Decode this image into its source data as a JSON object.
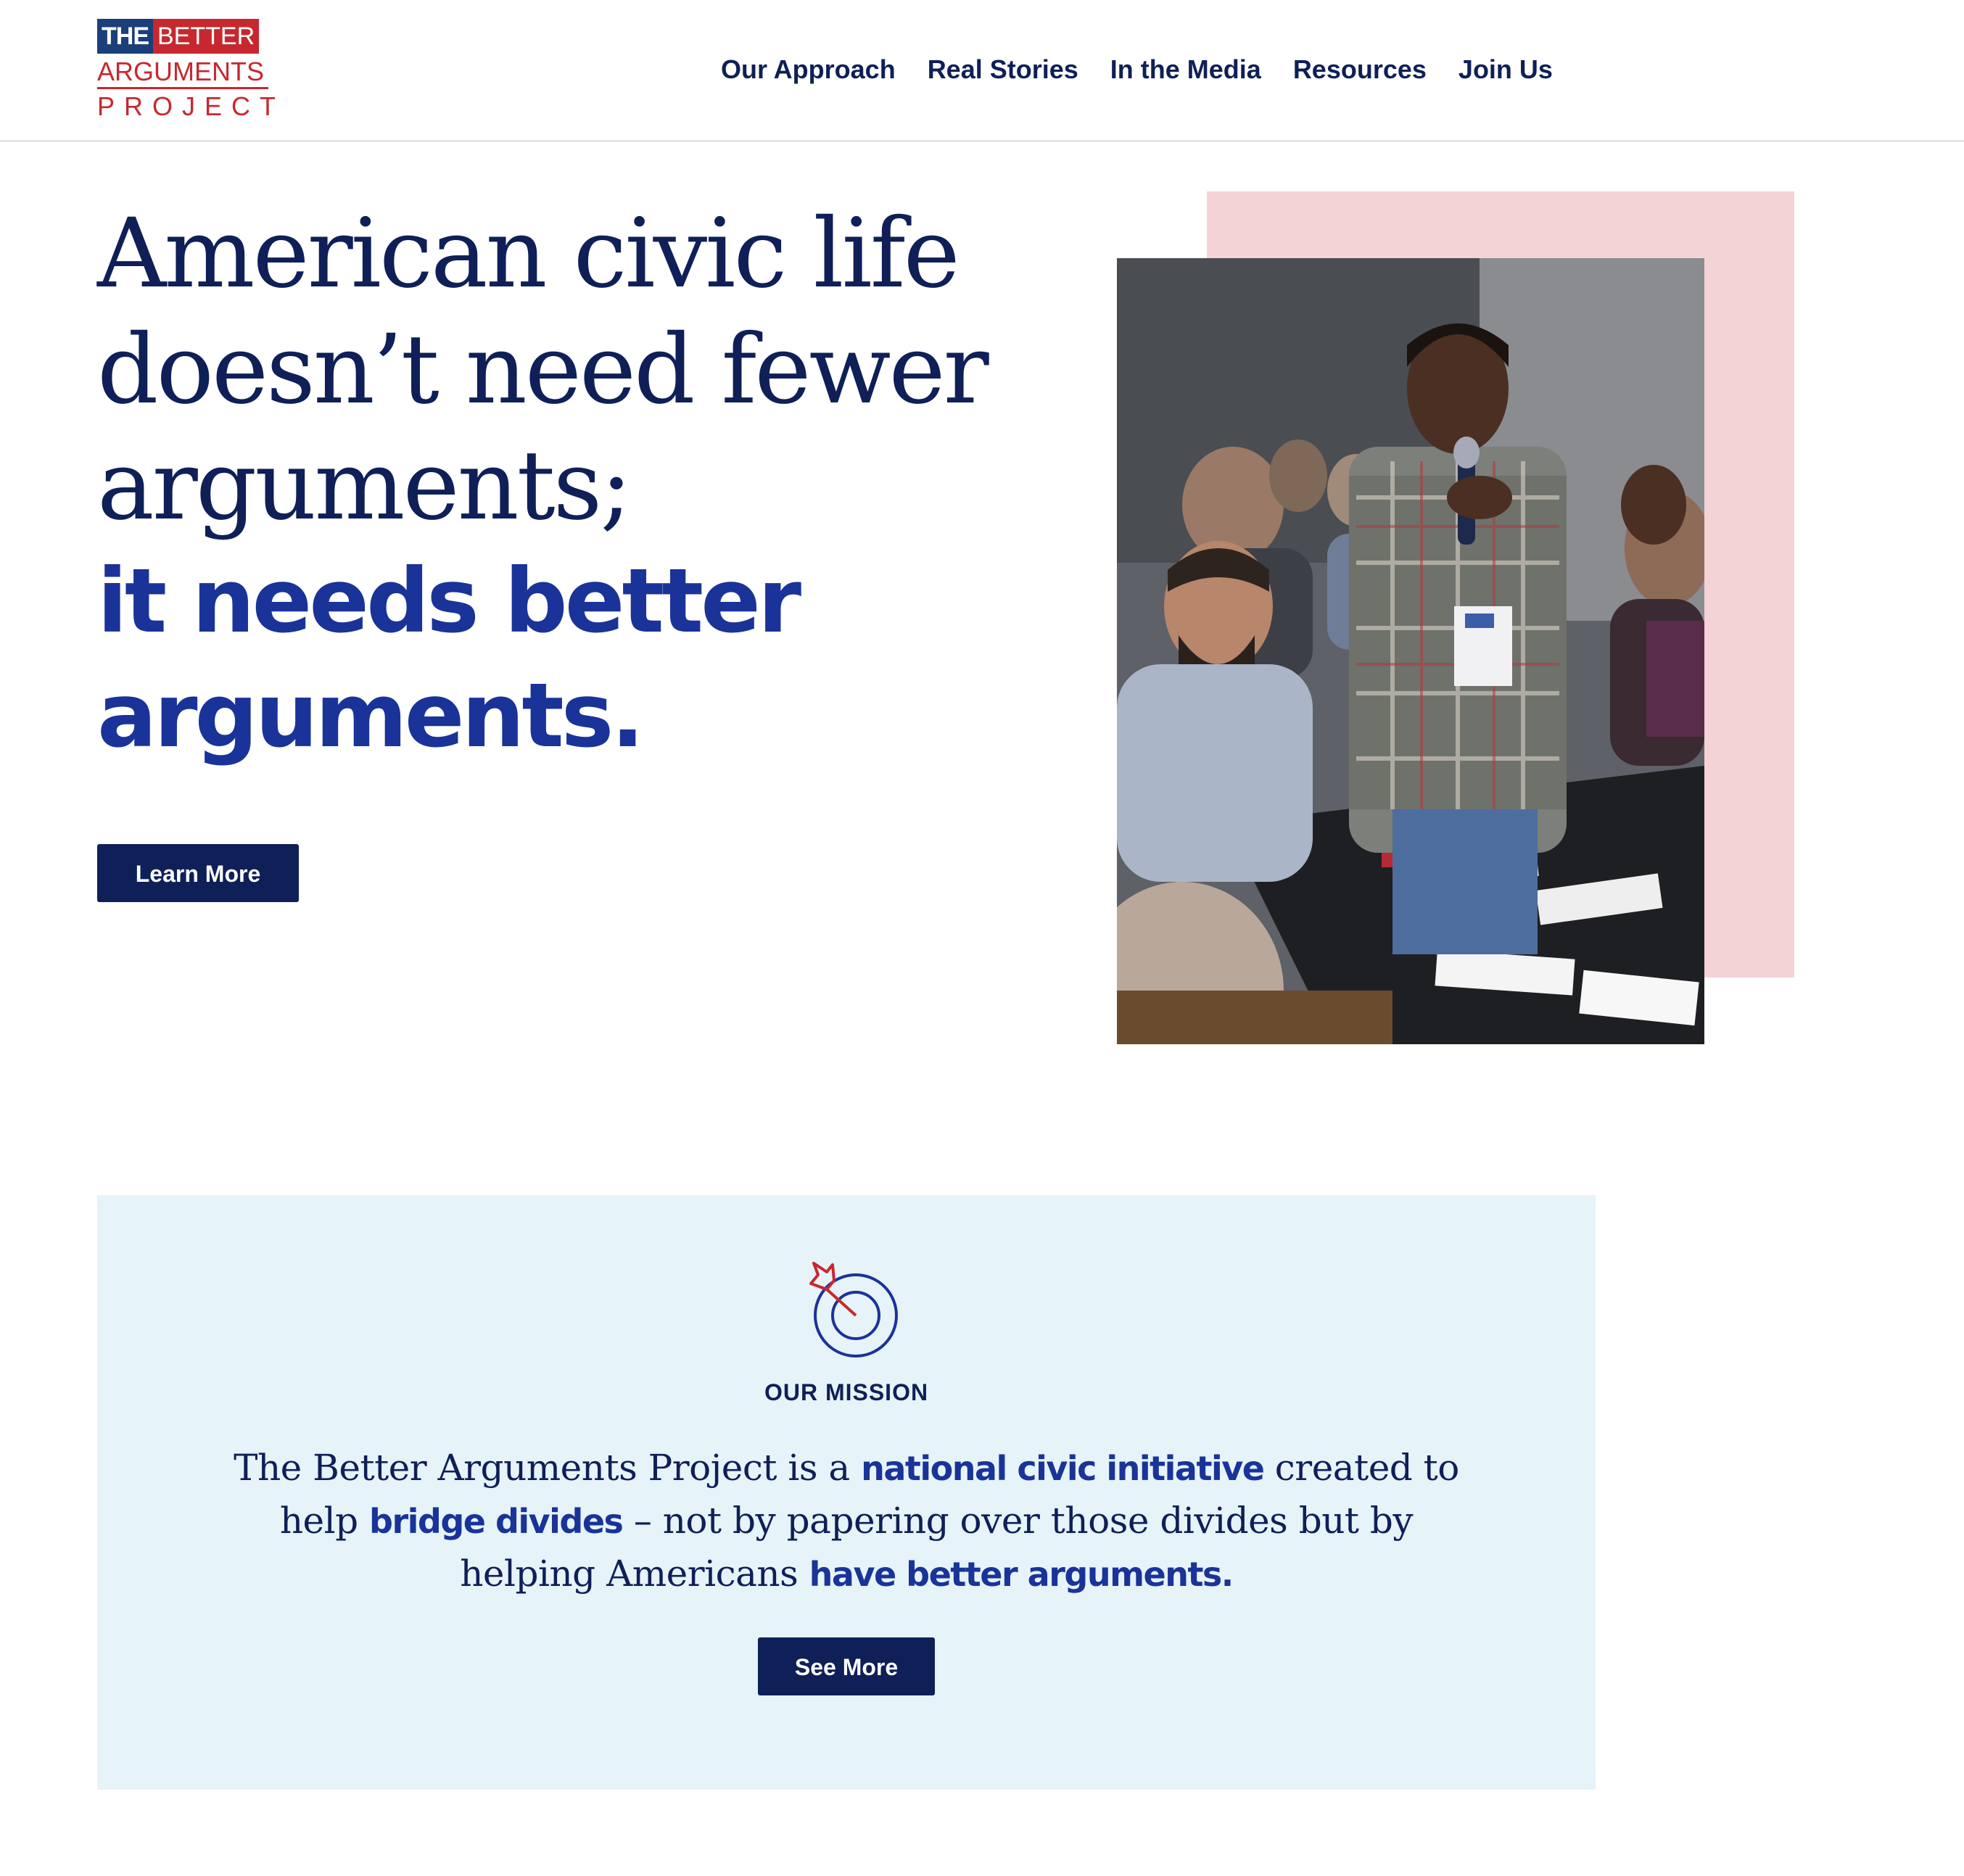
{
  "logo": {
    "the": "THE",
    "better": "BETTER",
    "arguments": "ARGUMENTS",
    "project": "PROJECT"
  },
  "nav": {
    "items": [
      {
        "label": "Our Approach"
      },
      {
        "label": "Real Stories"
      },
      {
        "label": "In the Media"
      },
      {
        "label": "Resources"
      },
      {
        "label": "Join Us"
      }
    ]
  },
  "hero": {
    "line1": "American civic life",
    "line2": "doesn’t need fewer",
    "line3": "arguments;",
    "bold1": "it needs better",
    "bold2": "arguments.",
    "button_label": "Learn More"
  },
  "mission": {
    "label": "OUR MISSION",
    "text_1": "The Better Arguments Project is a ",
    "highlight_1": "national civic initiative",
    "text_2": " created to help ",
    "highlight_2": "bridge divides",
    "text_3": " – not by papering over those divides but by helping Americans ",
    "highlight_3": "have better arguments.",
    "button_label": "See More"
  },
  "colors": {
    "navy": "#0f1f57",
    "royal_blue": "#1a3399",
    "brand_red": "#c7282f",
    "pink_block": "#f4d3d6",
    "mission_bg": "#e6f3f8"
  }
}
